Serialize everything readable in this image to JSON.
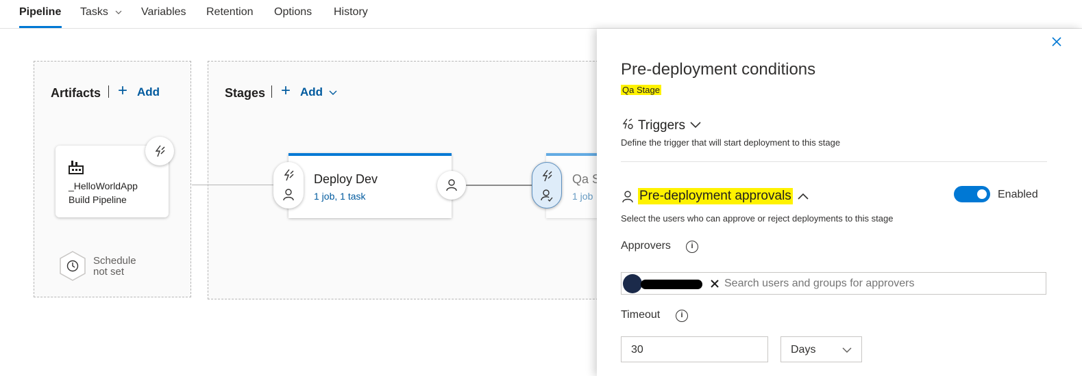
{
  "tabs": [
    {
      "label": "Pipeline"
    },
    {
      "label": "Tasks"
    },
    {
      "label": "Variables"
    },
    {
      "label": "Retention"
    },
    {
      "label": "Options"
    },
    {
      "label": "History"
    }
  ],
  "artifacts": {
    "title": "Artifacts",
    "add_label": "Add",
    "artifact_name_line1": "_HelloWorldApp",
    "artifact_name_line2": "Build Pipeline",
    "schedule_line1": "Schedule",
    "schedule_line2": "not set"
  },
  "stages": {
    "title": "Stages",
    "add_label": "Add",
    "items": [
      {
        "name": "Deploy Dev",
        "detail": "1 job, 1 task"
      },
      {
        "name": "Qa S",
        "detail": "1 job"
      }
    ]
  },
  "panel": {
    "title": "Pre-deployment conditions",
    "stage_name": "Qa Stage",
    "triggers": {
      "heading": "Triggers",
      "description": "Define the trigger that will start deployment to this stage"
    },
    "approvals": {
      "heading": "Pre-deployment approvals",
      "description": "Select the users who can approve or reject deployments to this stage",
      "toggle_label": "Enabled",
      "enabled": true,
      "approvers_label": "Approvers",
      "search_placeholder": "Search users and groups for approvers",
      "timeout_label": "Timeout",
      "timeout_value": "30",
      "timeout_unit": "Days"
    }
  },
  "colors": {
    "accent": "#0078d4",
    "link": "#005a9e",
    "highlight": "#fff200",
    "qa_stage_trigger_bg": "#deecf9"
  },
  "icons": [
    "chevron-down-icon",
    "plus-icon",
    "lightning-icon",
    "person-icon",
    "person-check-icon",
    "building-icon",
    "clock-icon",
    "close-icon",
    "trigger-icon",
    "chevron-up-icon",
    "info-icon",
    "remove-icon"
  ]
}
